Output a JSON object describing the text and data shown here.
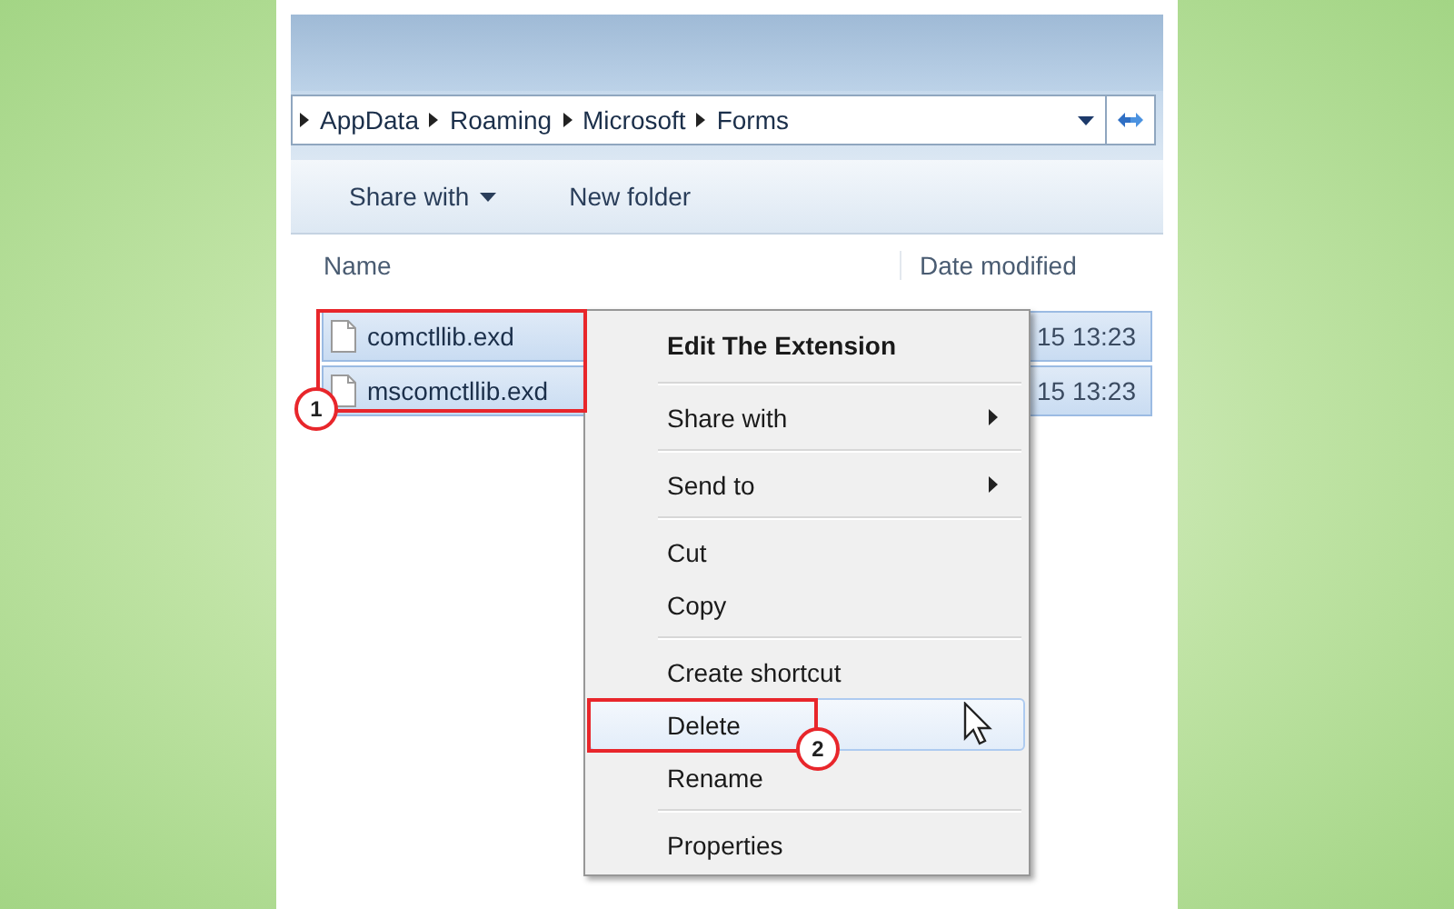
{
  "address_bar": {
    "path": [
      "AppData",
      "Roaming",
      "Microsoft",
      "Forms"
    ]
  },
  "toolbar": {
    "buttons": [
      {
        "label": "Share with",
        "dropdown": true
      },
      {
        "label": "New folder",
        "dropdown": false
      }
    ]
  },
  "columns": [
    "Name",
    "Date modified"
  ],
  "files": [
    {
      "name": "comctllib.exd",
      "date": "15 13:23",
      "selected": true
    },
    {
      "name": "mscomctllib.exd",
      "date": "15 13:23",
      "selected": true
    }
  ],
  "context_menu": [
    {
      "kind": "bold",
      "label": "Edit The Extension"
    },
    {
      "kind": "separator"
    },
    {
      "kind": "submenu",
      "label": "Share with"
    },
    {
      "kind": "separator"
    },
    {
      "kind": "submenu",
      "label": "Send to"
    },
    {
      "kind": "separator"
    },
    {
      "kind": "item",
      "label": "Cut",
      "selected": false
    },
    {
      "kind": "item",
      "label": "Copy",
      "selected": false
    },
    {
      "kind": "separator"
    },
    {
      "kind": "item",
      "label": "Create shortcut",
      "selected": false
    },
    {
      "kind": "item",
      "label": "Delete",
      "selected": true
    },
    {
      "kind": "item",
      "label": "Rename",
      "selected": false
    },
    {
      "kind": "separator"
    },
    {
      "kind": "item",
      "label": "Properties",
      "selected": false
    }
  ],
  "annotations": [
    {
      "label": "1"
    },
    {
      "label": "2"
    }
  ]
}
